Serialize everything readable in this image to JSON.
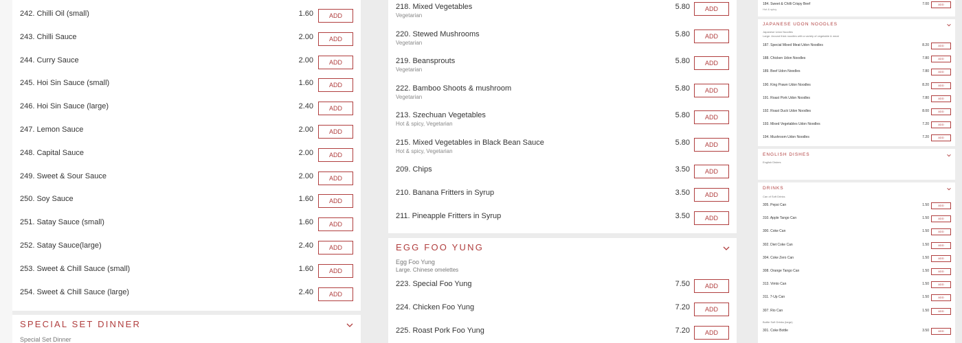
{
  "theme": {
    "accent": "#b03d3d",
    "text": "#333333",
    "muted": "#888888",
    "background": "#ececec"
  },
  "add_label": "ADD",
  "left": {
    "items": [
      {
        "name": "242. Chilli Oil (small)",
        "price": "1.60"
      },
      {
        "name": "243. Chilli Sauce",
        "price": "2.00"
      },
      {
        "name": "244. Curry Sauce",
        "price": "2.00"
      },
      {
        "name": "245. Hoi Sin Sauce (small)",
        "price": "1.60"
      },
      {
        "name": "246. Hoi Sin Sauce (large)",
        "price": "2.40"
      },
      {
        "name": "247. Lemon Sauce",
        "price": "2.00"
      },
      {
        "name": "248. Capital Sauce",
        "price": "2.00"
      },
      {
        "name": "249. Sweet & Sour Sauce",
        "price": "2.00"
      },
      {
        "name": "250. Soy Sauce",
        "price": "1.60"
      },
      {
        "name": "251. Satay Sauce (small)",
        "price": "1.60"
      },
      {
        "name": "252. Satay Sauce(large)",
        "price": "2.40"
      },
      {
        "name": "253. Sweet & Chill Sauce (small)",
        "price": "1.60"
      },
      {
        "name": "254. Sweet & Chill Sauce (large)",
        "price": "2.40"
      }
    ],
    "next_section": {
      "title": "SPECIAL SET DINNER",
      "description": "Special Set Dinner"
    }
  },
  "middle": {
    "items": [
      {
        "name": "218. Mixed Vegetables",
        "sub": "Vegetarian",
        "price": "5.80"
      },
      {
        "name": "220. Stewed Mushrooms",
        "sub": "Vegetarian",
        "price": "5.80"
      },
      {
        "name": "219. Beansprouts",
        "sub": "Vegetarian",
        "price": "5.80"
      },
      {
        "name": "222. Bamboo Shoots & mushroom",
        "sub": "Vegetarian",
        "price": "5.80"
      },
      {
        "name": "213. Szechuan Vegetables",
        "sub": "Hot & spicy,  Vegetarian",
        "price": "5.80"
      },
      {
        "name": "215. Mixed Vegetables in Black Bean Sauce",
        "sub": "Hot & spicy,  Vegetarian",
        "price": "5.80"
      },
      {
        "name": "209. Chips",
        "sub": "",
        "price": "3.50"
      },
      {
        "name": "210. Banana Fritters in Syrup",
        "sub": "",
        "price": "3.50"
      },
      {
        "name": "211. Pineapple Fritters in Syrup",
        "sub": "",
        "price": "3.50"
      }
    ],
    "section": {
      "title": "EGG FOO YUNG",
      "desc1": "Egg Foo Yung",
      "desc2": "Large.  Chinese omelettes",
      "items": [
        {
          "name": "223. Special Foo Yung",
          "price": "7.50"
        },
        {
          "name": "224. Chicken Foo Yung",
          "price": "7.20"
        },
        {
          "name": "225. Roast Pork Foo Yung",
          "price": "7.20"
        }
      ]
    }
  },
  "right": {
    "top_item": {
      "name": "184. Sweet & Chilli Crispy Beef",
      "sub": "Hot & spicy",
      "price": "7.00"
    },
    "udon": {
      "title": "JAPANESE UDON NOODLES",
      "desc1": "Japanese Udon Noodles",
      "desc2": "Large. Around thick noodles with a variety of vegetable & meat",
      "items": [
        {
          "name": "187. Special Mixed Meat Udon Noodles",
          "price": "8.20"
        },
        {
          "name": "188. Chicken Udon Noodles",
          "price": "7.80"
        },
        {
          "name": "189. Beef Udon Noodles",
          "price": "7.80"
        },
        {
          "name": "190. King Prawn Udon Noodles",
          "price": "8.20"
        },
        {
          "name": "191. Roast Pork Udon Noodles",
          "price": "7.80"
        },
        {
          "name": "192. Roast Duck Udon Noodles",
          "price": "8.00"
        },
        {
          "name": "193. Mixed Vegetables Udon Noodles",
          "price": "7.20"
        },
        {
          "name": "194. Mushroom Udon Noodles",
          "price": "7.20"
        }
      ]
    },
    "english": {
      "title": "ENGLISH DISHES",
      "desc1": "English Dishes"
    },
    "drinks": {
      "title": "DRINKS",
      "group1": "Can of Soft Drinks",
      "items": [
        {
          "name": "305. Pepsi Can",
          "price": "1.50"
        },
        {
          "name": "310. Apple Tango Can",
          "price": "1.50"
        },
        {
          "name": "300. Coke Can",
          "price": "1.50"
        },
        {
          "name": "302. Diet Coke Can",
          "price": "1.50"
        },
        {
          "name": "304. Coke Zero Can",
          "price": "1.50"
        },
        {
          "name": "308. Orange Tango Can",
          "price": "1.50"
        },
        {
          "name": "313. Vimto Can",
          "price": "1.50"
        },
        {
          "name": "311. 7-Up Can",
          "price": "1.50"
        },
        {
          "name": "307. Rio Can",
          "price": "1.50"
        }
      ],
      "group2": "Bottle Soft Drinks (large)",
      "items2": [
        {
          "name": "301. Coke Bottle",
          "price": "3.50"
        }
      ]
    }
  }
}
